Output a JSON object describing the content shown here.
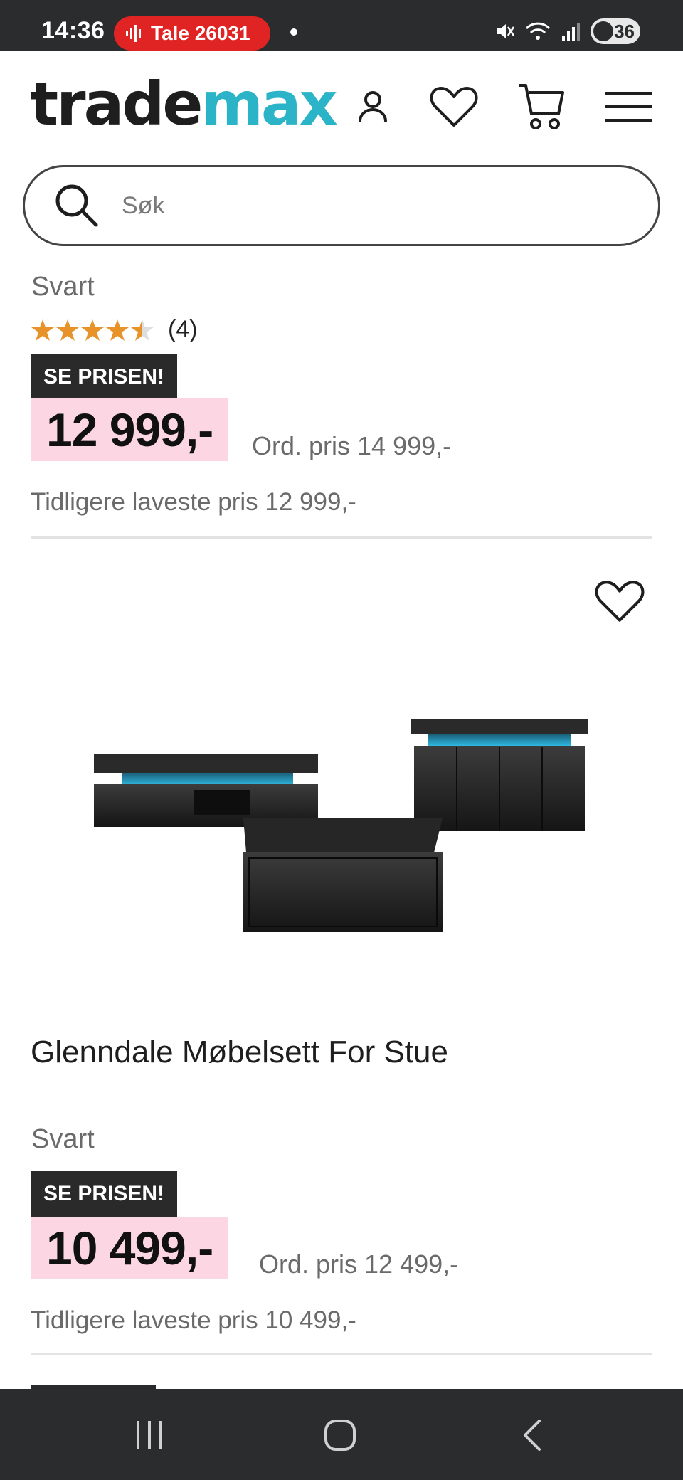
{
  "status_bar": {
    "time": "14:36",
    "recording_label": "Tale 26031",
    "battery_level": "36"
  },
  "header": {
    "logo_part1": "trade",
    "logo_part2": "max",
    "brand_color": "#2bb3c8",
    "icons": [
      "account-icon",
      "heart-icon",
      "cart-icon",
      "menu-icon"
    ]
  },
  "search": {
    "placeholder": "Søk"
  },
  "products": [
    {
      "color": "Svart",
      "rating": 4.5,
      "rating_count": "(4)",
      "tag": "SE PRISEN!",
      "price": "12 999,-",
      "ord_price": "Ord. pris 14 999,-",
      "lowest_price": "Tidligere laveste pris 12 999,-"
    },
    {
      "title": "Glenndale Møbelsett For Stue",
      "color": "Svart",
      "tag": "SE PRISEN!",
      "price": "10 499,-",
      "ord_price": "Ord. pris 12 499,-",
      "lowest_price": "Tidligere laveste pris 10 499,-"
    }
  ],
  "accent_colors": {
    "price_bg": "#fcd6e3",
    "tag_bg": "#2a2a2a",
    "star": "#e8932a",
    "led": "#2fb8e0"
  }
}
